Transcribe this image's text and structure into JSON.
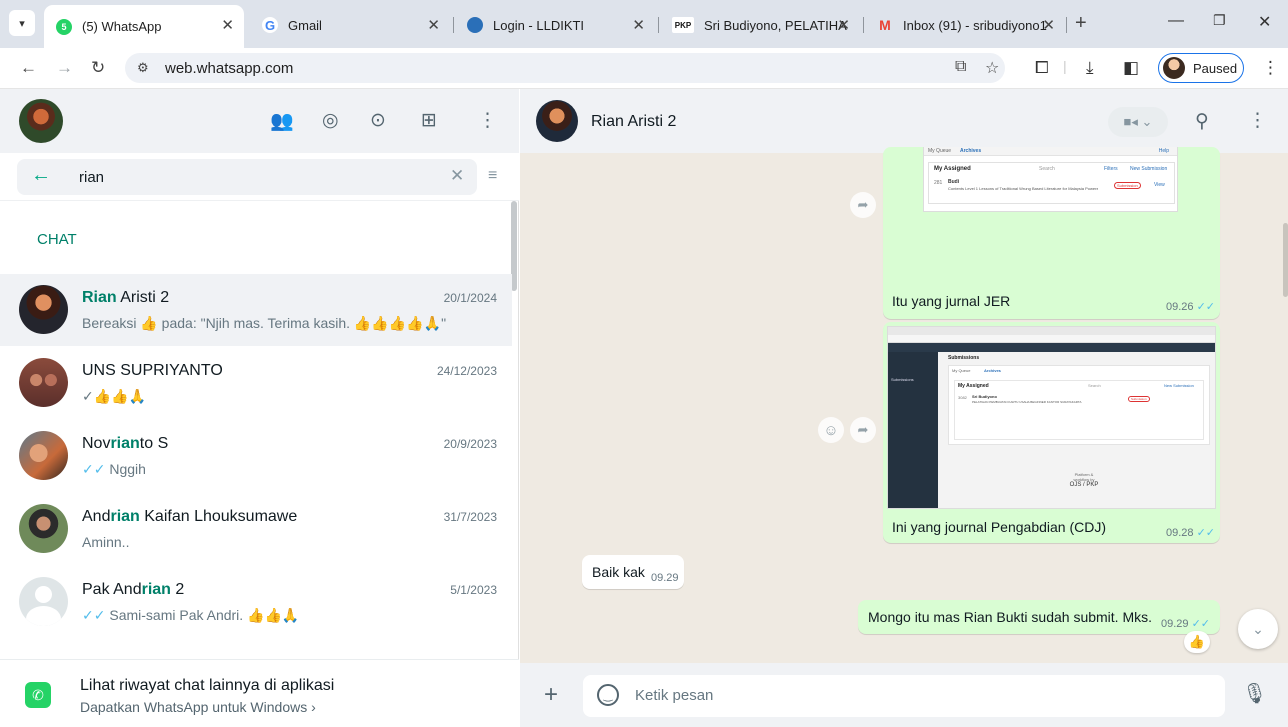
{
  "browser": {
    "tabs": [
      {
        "title": "(5) WhatsApp",
        "favicon": "whatsapp-icon",
        "active": true
      },
      {
        "title": "Gmail",
        "favicon": "google-icon",
        "active": false
      },
      {
        "title": "Login - LLDIKTI",
        "favicon": "globe-icon",
        "active": false
      },
      {
        "title": "Sri Budiyono, PELATIHAN",
        "favicon": "pkp-icon",
        "active": false
      },
      {
        "title": "Inbox (91) - sribudiyono1",
        "favicon": "gmail-icon",
        "active": false
      }
    ],
    "url": "web.whatsapp.com",
    "profile_status": "Paused",
    "favicon_badge": "5",
    "pkp_label": "PKP",
    "gmail_letter": "M"
  },
  "left_panel": {
    "search_query": "rian",
    "section_label": "CHAT",
    "chats": [
      {
        "name_parts": [
          "",
          "Rian",
          " Aristi 2"
        ],
        "date": "20/1/2024",
        "preview": "Bereaksi 👍 pada: \"Njih mas. Terima kasih. 👍👍👍👍🙏\"",
        "tick": "",
        "selected": true
      },
      {
        "name_parts": [
          "UNS SUPRIYANTO",
          "",
          ""
        ],
        "date": "24/12/2023",
        "preview": "👍👍🙏",
        "tick": "✓",
        "selected": false
      },
      {
        "name_parts": [
          "Nov",
          "rian",
          "to S"
        ],
        "date": "20/9/2023",
        "preview": "Nggih",
        "tick": "✓✓",
        "selected": false
      },
      {
        "name_parts": [
          "And",
          "rian",
          " Kaifan Lhouksumawe"
        ],
        "date": "31/7/2023",
        "preview": "Aminn..",
        "tick": "",
        "selected": false
      },
      {
        "name_parts": [
          "Pak And",
          "rian",
          " 2"
        ],
        "date": "5/1/2023",
        "preview": "Sami-sami Pak Andri. 👍👍🙏",
        "tick": "✓✓",
        "selected": false
      }
    ],
    "footer": {
      "title": "Lihat riwayat chat lainnya di aplikasi",
      "subtitle": "Dapatkan WhatsApp untuk Windows ›"
    }
  },
  "conversation": {
    "contact_name": "Rian Aristi 2",
    "messages": [
      {
        "id": "m1",
        "type": "image",
        "direction": "out",
        "caption": "Itu yang jurnal JER",
        "time": "09.26",
        "ticks": "✓✓"
      },
      {
        "id": "m2",
        "type": "image",
        "direction": "out",
        "caption": "Ini yang journal Pengabdian (CDJ)",
        "time": "09.28",
        "ticks": "✓✓"
      },
      {
        "id": "m3",
        "type": "text",
        "direction": "in",
        "text": "Baik kak",
        "time": "09.29"
      },
      {
        "id": "m4",
        "type": "text",
        "direction": "out",
        "text": "Mongo itu mas  Rian Bukti sudah submit. Mks.",
        "time": "09.29",
        "ticks": "✓✓",
        "reaction": "👍"
      }
    ],
    "screenshot1": {
      "tabs": [
        "My Queue",
        "Archives"
      ],
      "title": "My Assigned",
      "search": "Search",
      "filters": "Filters",
      "new": "New Submission",
      "id": "281",
      "author": "Budi",
      "desc": "Contents Level 1 Lessons of Traditional Wrung Based Literature for Malaysia Powered",
      "badge": "Submission",
      "view": "View",
      "help": "Help"
    },
    "screenshot2": {
      "side": "Submissions",
      "header": "Submissions",
      "tabs": [
        "My Queue",
        "Archives"
      ],
      "title": "My Assigned",
      "search": "Search",
      "new": "New Submission",
      "id": "3082",
      "author": "Sri Budiyono",
      "desc": "PELATIHAN PEMBUATAN KARTU USAHA BEGINNER KANTOR SURATAKARTA",
      "badge": "Submission",
      "footer1": "Platform &",
      "footer2": "workflow by",
      "footer3": "OJS / PKP"
    },
    "composer_placeholder": "Ketik pesan"
  },
  "colors": {
    "accent": "#008069",
    "whatsapp_green": "#25d366",
    "bubble_out": "#d9fdd3",
    "chat_bg": "#efeae2",
    "read_tick": "#53bdeb"
  }
}
